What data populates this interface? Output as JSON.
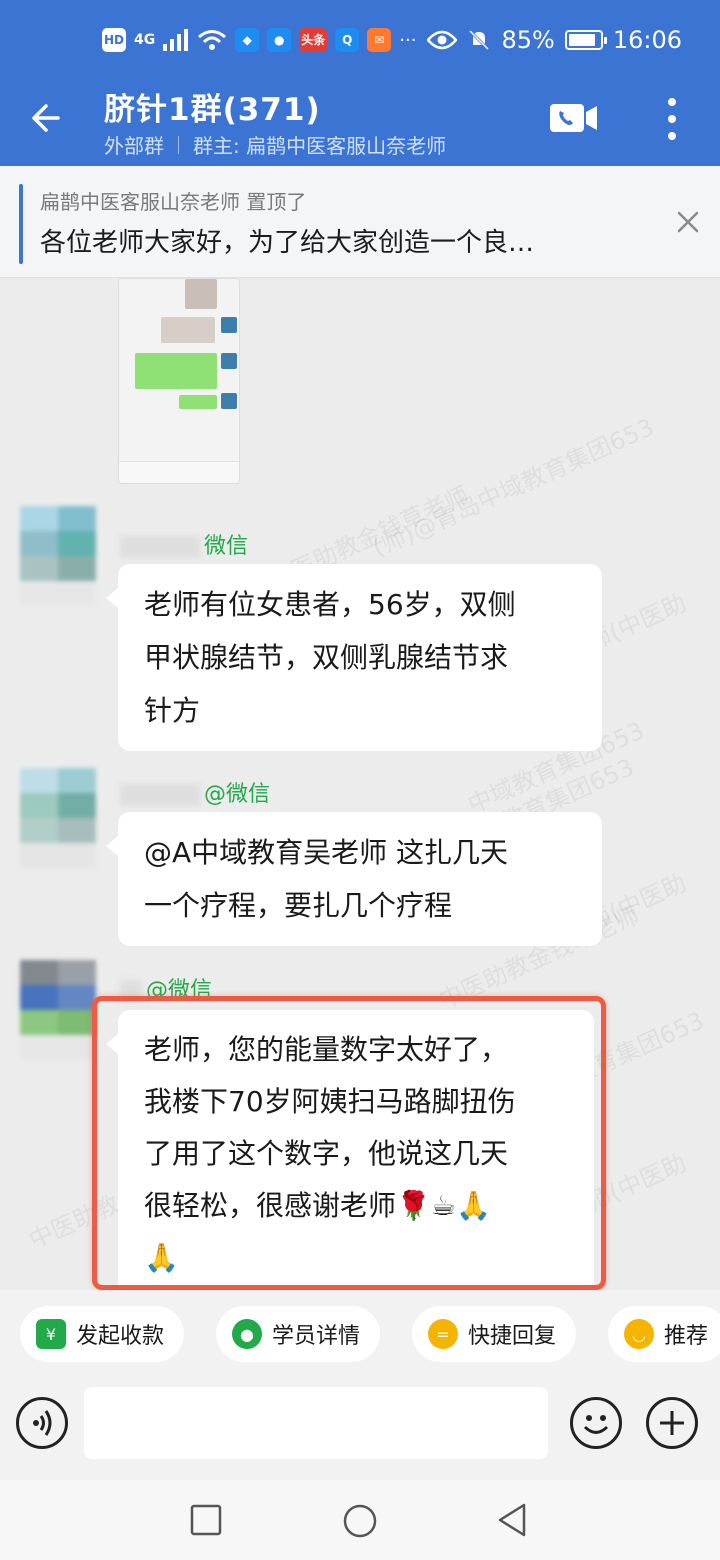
{
  "status_bar": {
    "network": "4G",
    "hd": "HD",
    "battery": "85%",
    "battery_level": 0.85,
    "time": "16:06",
    "app_chip_toutiao": "头条"
  },
  "header": {
    "title": "脐针1群(371)",
    "group_type": "外部群",
    "owner": "群主: 扁鹊中医客服山奈老师"
  },
  "pinned": {
    "who": "扁鹊中医客服山奈老师 置顶了",
    "text": "各位老师大家好，为了给大家创造一个良…"
  },
  "messages": [
    {
      "nick_suffix": "微信",
      "text_lines": [
        "老师有位女患者，56岁，双侧",
        "甲状腺结节，双侧乳腺结节求",
        "针方"
      ]
    },
    {
      "nick_suffix": "@微信",
      "text_lines": [
        "@A中域教育吴老师 这扎几天",
        "一个疗程，要扎几个疗程"
      ]
    },
    {
      "nick_suffix": "@微信",
      "text_lines": [
        "老师，您的能量数字太好了，",
        "我楼下70岁阿姨扫马路脚扭伤",
        "了用了这个数字，他说这几天",
        "很轻松，很感谢老师🌹☕🙏",
        "🙏"
      ]
    }
  ],
  "watermarks": [
    "(师)@青岛中域教育集团653",
    "中医助教金钱草老师",
    "老师(中医助",
    "中域教育集团653"
  ],
  "quick_actions": [
    {
      "label": "发起收款",
      "icon": "payment-icon",
      "color": "#21a94a"
    },
    {
      "label": "学员详情",
      "icon": "student-icon",
      "color": "#21a94a"
    },
    {
      "label": "快捷回复",
      "icon": "quick-reply-icon",
      "color": "#f5b400"
    },
    {
      "label": "推荐",
      "icon": "recommend-icon",
      "color": "#f5b400"
    }
  ]
}
